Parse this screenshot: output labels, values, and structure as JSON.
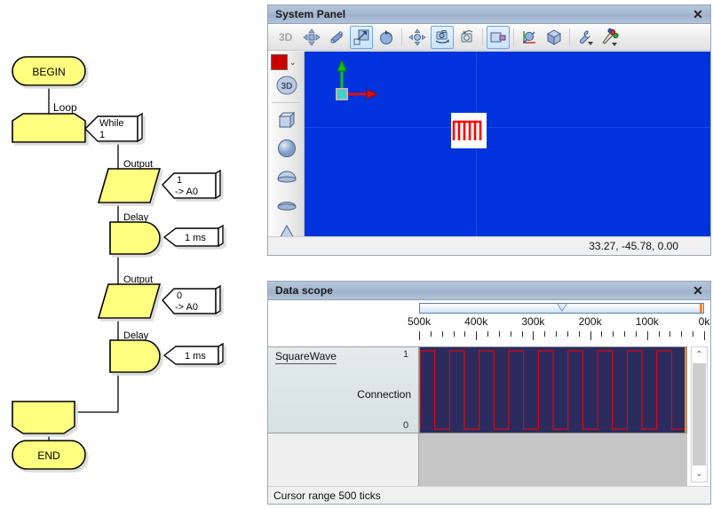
{
  "flowchart": {
    "nodes": [
      {
        "id": "begin",
        "label": "BEGIN",
        "shape": "terminator"
      },
      {
        "id": "loop",
        "label": "",
        "shape": "loop-start",
        "edge_label": "Loop"
      },
      {
        "id": "while",
        "label": "While\n1",
        "shape": "comment",
        "line1": "While",
        "line2": "1"
      },
      {
        "id": "out1",
        "label": "",
        "shape": "parallelogram",
        "edge_label": "Output"
      },
      {
        "id": "out1note",
        "line1": "1",
        "line2": "-> A0",
        "shape": "comment"
      },
      {
        "id": "delay1",
        "label": "",
        "shape": "delay",
        "edge_label": "Delay"
      },
      {
        "id": "delay1note",
        "line1": "1 ms",
        "shape": "comment"
      },
      {
        "id": "out2",
        "label": "",
        "shape": "parallelogram",
        "edge_label": "Output"
      },
      {
        "id": "out2note",
        "line1": "0",
        "line2": "-> A0",
        "shape": "comment"
      },
      {
        "id": "delay2",
        "label": "",
        "shape": "delay",
        "edge_label": "Delay"
      },
      {
        "id": "delay2note",
        "line1": "1 ms",
        "shape": "comment"
      },
      {
        "id": "loopend",
        "label": "",
        "shape": "loop-end"
      },
      {
        "id": "end",
        "label": "END",
        "shape": "terminator"
      }
    ],
    "labels": {
      "begin": "BEGIN",
      "end": "END",
      "loop": "Loop",
      "while_1": "While",
      "while_2": "1",
      "output_1": "Output",
      "note1_1": "1",
      "note1_2": "-> A0",
      "delay_1": "Delay",
      "delaynote1": "1 ms",
      "output_2": "Output",
      "note2_1": "0",
      "note2_2": "-> A0",
      "delay_2": "Delay",
      "delaynote2": "1 ms"
    },
    "colors": {
      "fill": "#ffff80",
      "stroke": "#000000",
      "shadow": "#c0c0c0"
    }
  },
  "system_panel": {
    "title": "System Panel",
    "close_label": "✕",
    "toolbar": {
      "mode_label": "3D",
      "buttons": [
        {
          "name": "move-icon",
          "selected": false
        },
        {
          "name": "scale-stretch-icon",
          "selected": false
        },
        {
          "name": "resize-icon",
          "selected": true
        },
        {
          "name": "rotate-icon",
          "selected": false
        },
        {
          "name": "pan-icon",
          "selected": false
        },
        {
          "name": "orbit-camera-icon",
          "selected": true
        },
        {
          "name": "rotate-camera-icon",
          "selected": false
        },
        {
          "name": "perspective-icon",
          "selected": true
        },
        {
          "name": "axis-sphere-icon",
          "selected": false
        },
        {
          "name": "cube-icon",
          "selected": false
        },
        {
          "name": "wrench-icon",
          "selected": false
        },
        {
          "name": "tools-icon",
          "selected": false
        }
      ]
    },
    "left_toolbar": {
      "color_swatch": "#cc0000",
      "dropdown_caret": "⌄",
      "items": [
        {
          "name": "3d-badge-icon",
          "label": "3D"
        },
        {
          "name": "box-shape-icon",
          "label": ""
        },
        {
          "name": "sphere-shape-icon",
          "label": ""
        },
        {
          "name": "dome-shape-icon",
          "label": ""
        },
        {
          "name": "disc-shape-icon",
          "label": ""
        },
        {
          "name": "cone-shape-icon",
          "label": ""
        }
      ]
    },
    "viewport": {
      "background_color": "#0033dd",
      "axis_x_color": "#e01010",
      "axis_y_color": "#15c015",
      "object_name": "square-wave-texture"
    },
    "status": {
      "coordinates": "33.27, -45.78, 0.00"
    }
  },
  "data_scope": {
    "title": "Data scope",
    "close_label": "✕",
    "track": {
      "signal_name": "SquareWave",
      "connection_label": "Connection",
      "value_max": "1",
      "value_min": "0"
    },
    "status": "Cursor range 500 ticks",
    "scroll_up": "⌃",
    "scroll_down": "⌄",
    "chart_data": {
      "type": "line",
      "title": "SquareWave",
      "xlabel": "",
      "ylabel": "",
      "x_tick_labels": [
        "500k",
        "400k",
        "300k",
        "200k",
        "100k",
        "0k"
      ],
      "x_tick_values": [
        500000,
        400000,
        300000,
        200000,
        100000,
        0
      ],
      "minor_ticks_between": 4,
      "x_axis_direction": "descending",
      "ylim": [
        0,
        1
      ],
      "y_tick_labels": [
        "1",
        "0"
      ],
      "grid": false,
      "legend_position": "left",
      "series": [
        {
          "name": "SquareWave",
          "color": "#ff0000",
          "waveform": "square",
          "duty_cycle": 0.5,
          "period_ticks": 55000,
          "cycles_visible": 9,
          "amplitude_high": 1,
          "amplitude_low": 0
        }
      ],
      "plot_background": "#2b2b5e",
      "cursor_range_ticks": 500
    }
  }
}
